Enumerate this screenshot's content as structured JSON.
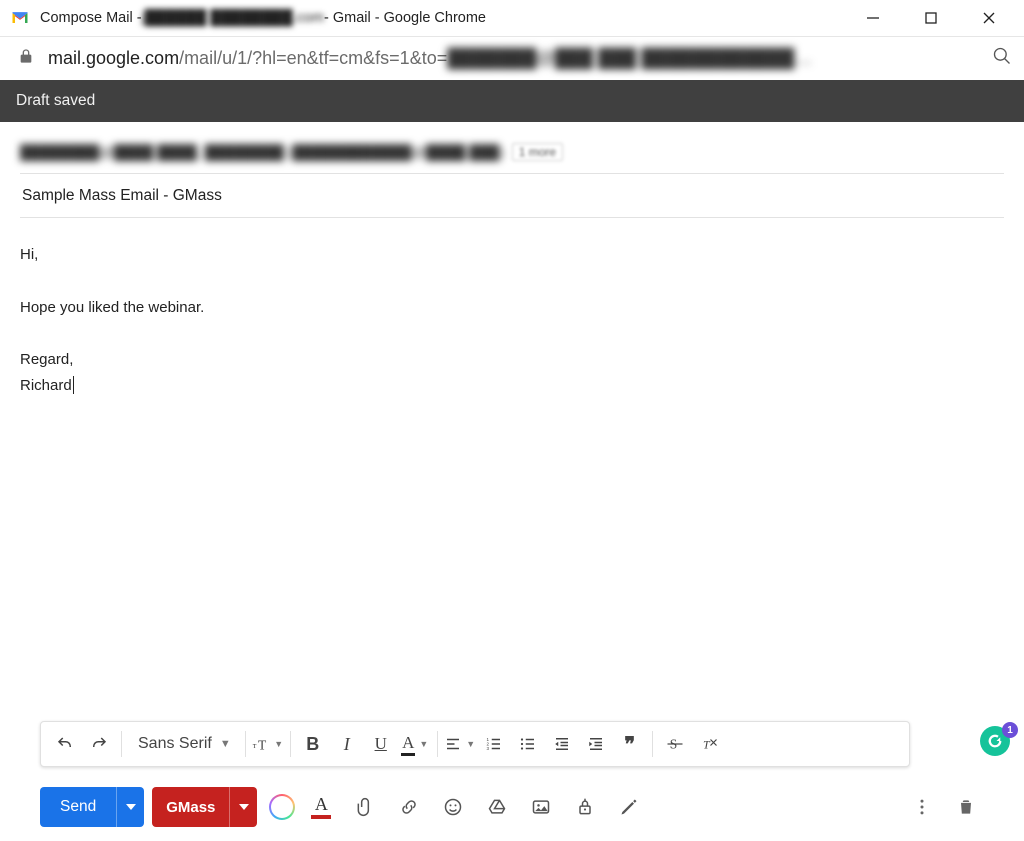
{
  "window": {
    "title_prefix": "Compose Mail - ",
    "title_blur": "j██████ ████████.com",
    "title_suffix": " - Gmail - Google Chrome"
  },
  "url": {
    "host": "mail.google.com",
    "path": "/mail/u/1/?hl=en&tf=cm&fs=1&to=",
    "blur": "███████@███ ███ ████████████…"
  },
  "draft_status": "Draft saved",
  "compose": {
    "to_blur": "████████@████ ████, ████████ (████████████@████.███)",
    "more_count": "1 more",
    "subject": "Sample Mass Email - GMass",
    "body_l1": "Hi,",
    "body_l2": "Hope you liked the webinar.",
    "body_l3": "Regard,",
    "body_l4": "Richard"
  },
  "fmt": {
    "font": "Sans Serif",
    "bold": "B",
    "italic": "I",
    "underline": "U",
    "textcolor": "A",
    "quote": "❞"
  },
  "grammarly_badge": "1",
  "actions": {
    "send": "Send",
    "gmass": "GMass",
    "textcolor": "A"
  }
}
